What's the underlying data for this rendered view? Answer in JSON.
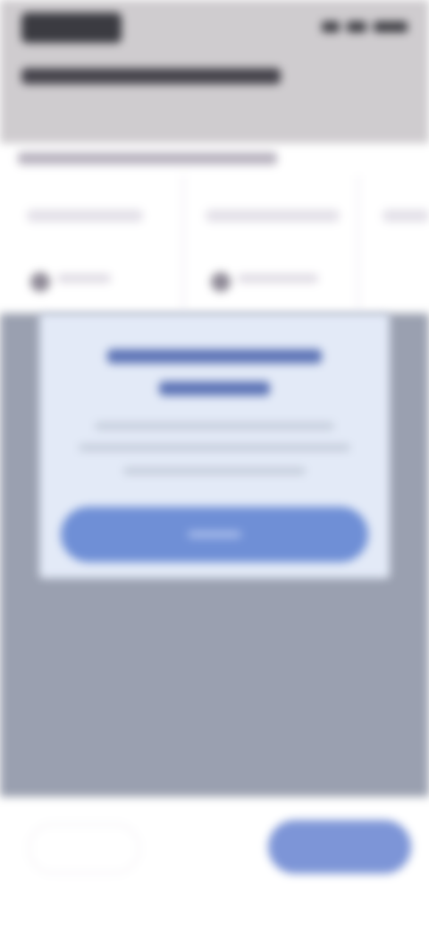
{
  "colors": {
    "header_bg": "#cfcccf",
    "scrim": "#9aa0b0",
    "dialog_bg": "#e3eaf7",
    "primary": "#6f8fd6",
    "dialog_title": "#4a64ab"
  },
  "icons": {
    "card_meta": "avatar-icon"
  },
  "header": {
    "title": ""
  },
  "dialog": {
    "title": "",
    "body": "",
    "button_label": ""
  },
  "bottom_bar": {
    "secondary_label": "",
    "primary_label": ""
  }
}
